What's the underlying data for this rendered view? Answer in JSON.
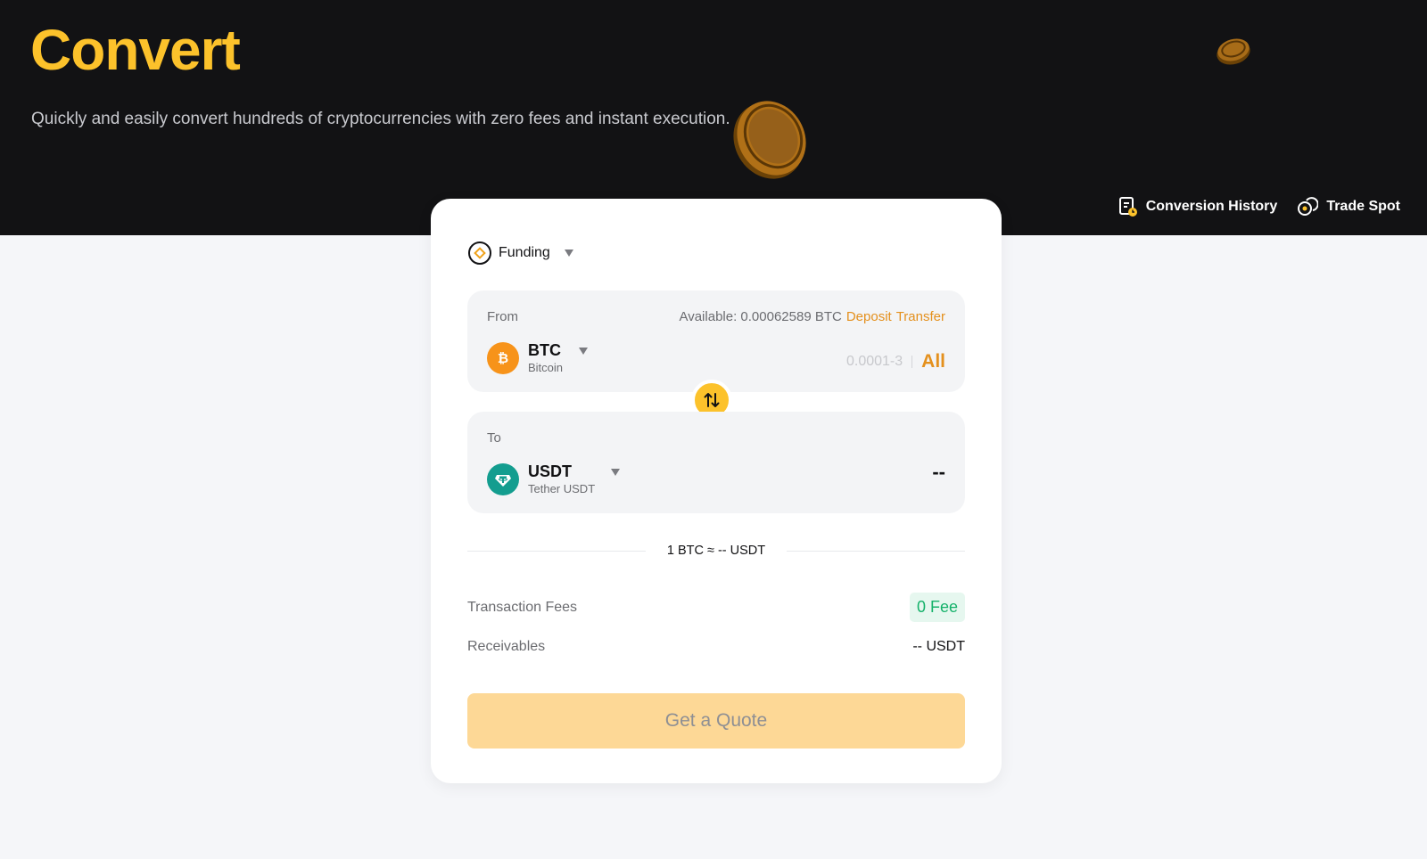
{
  "page": {
    "title": "Convert",
    "subtitle": "Quickly and easily convert hundreds of cryptocurrencies with zero fees and instant execution."
  },
  "header_links": [
    {
      "label": "Conversion History",
      "icon": "history-doc-icon"
    },
    {
      "label": "Trade Spot",
      "icon": "trade-spot-icon"
    }
  ],
  "account": {
    "label": "Funding",
    "icon": "funding-icon"
  },
  "from": {
    "label": "From",
    "available": "Available: 0.00062589 BTC",
    "deposit_link": "Deposit",
    "transfer_link": "Transfer",
    "coin_symbol": "BTC",
    "coin_name": "Bitcoin",
    "amount_placeholder": "0.0001-3",
    "all_label": "All"
  },
  "to": {
    "label": "To",
    "coin_symbol": "USDT",
    "coin_name": "Tether USDT",
    "amount": "--"
  },
  "rate": "1 BTC ≈ -- USDT",
  "fees": {
    "label": "Transaction Fees",
    "value": "0 Fee"
  },
  "receivables": {
    "label": "Receivables",
    "value": "-- USDT"
  },
  "quote_button": "Get a Quote",
  "colors": {
    "accent": "#fcc22b",
    "link_orange": "#e4901d",
    "hero_bg": "#121214",
    "fee_green": "#16b26b",
    "btc": "#f7931a",
    "usdt": "#139d8f"
  }
}
